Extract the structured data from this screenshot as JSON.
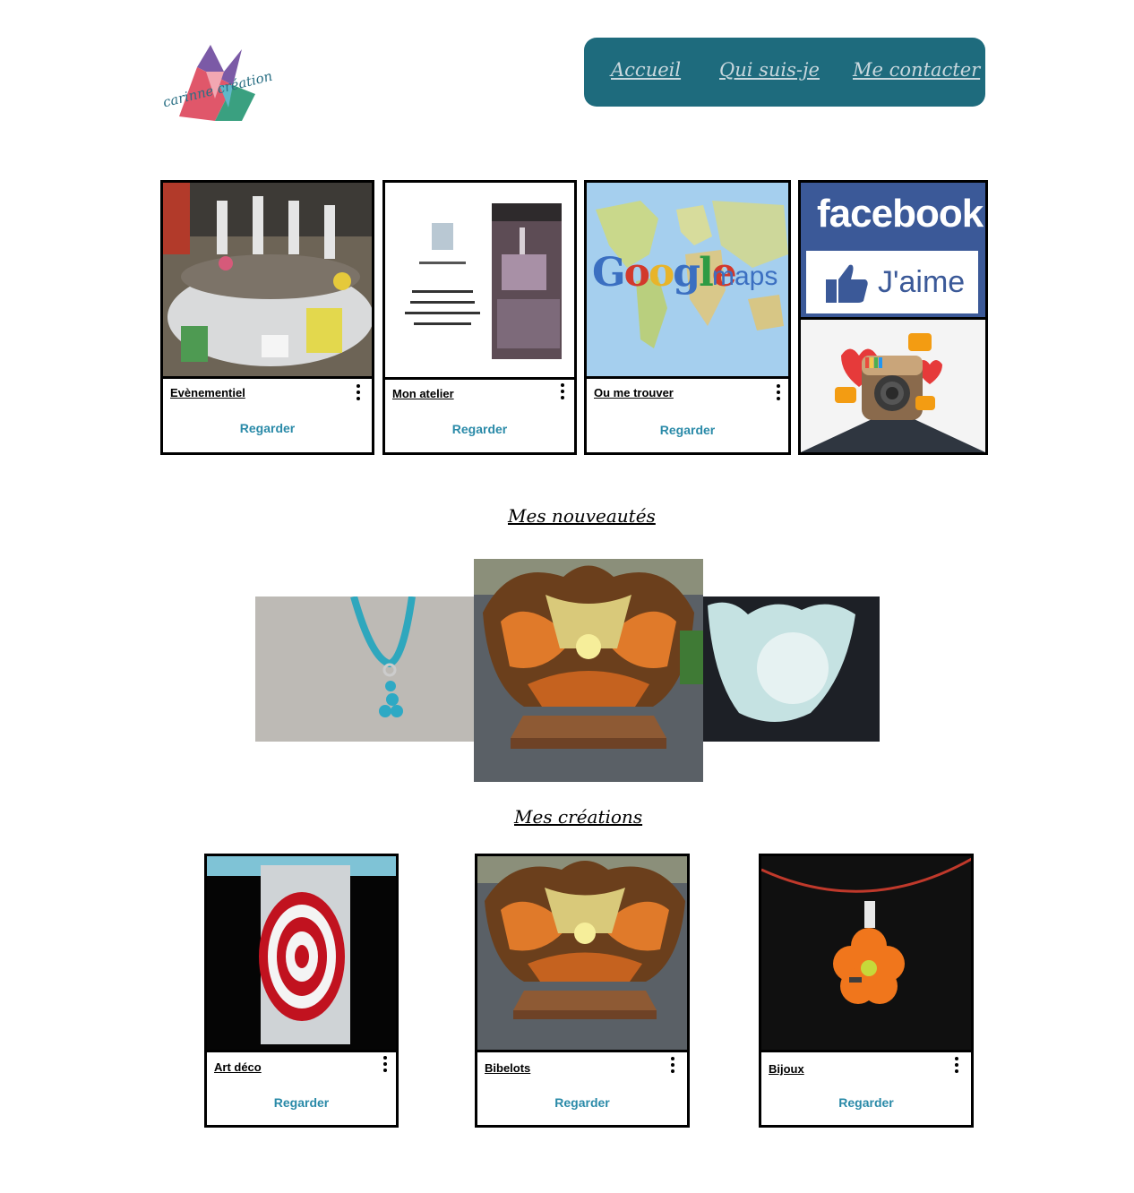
{
  "logo": {
    "text": "carinne création"
  },
  "nav": {
    "links": [
      "Accueil",
      "Qui suis-je",
      "Me contacter"
    ]
  },
  "top_cards": [
    {
      "title": "Evènementiel",
      "cta": "Regarder"
    },
    {
      "title": "Mon atelier",
      "cta": "Regarder"
    },
    {
      "title": "Ou me trouver",
      "cta": "Regarder"
    }
  ],
  "maps_logo": {
    "google": "Google",
    "maps": "maps"
  },
  "facebook": {
    "brand": "facebook",
    "like": "J'aime"
  },
  "new_section": {
    "title": "Mes nouveautés"
  },
  "creations_section": {
    "title": "Mes créations"
  },
  "creation_cards": [
    {
      "title": "Art déco",
      "cta": "Regarder"
    },
    {
      "title": "Bibelots",
      "cta": "Regarder"
    },
    {
      "title": "Bijoux",
      "cta": "Regarder"
    }
  ],
  "colors": {
    "nav_bg": "#1e6b7d",
    "cta": "#2a8aa8",
    "facebook": "#3b5998"
  }
}
